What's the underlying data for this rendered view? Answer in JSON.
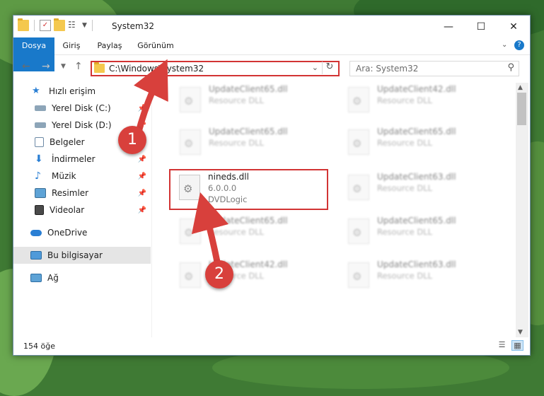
{
  "window": {
    "title": "System32"
  },
  "ribbon": {
    "tabs": [
      "Dosya",
      "Giriş",
      "Paylaş",
      "Görünüm"
    ]
  },
  "address": {
    "path": "C:\\Windows\\System32"
  },
  "search": {
    "placeholder": "Ara: System32"
  },
  "sidebar": {
    "items": [
      {
        "label": "Hızlı erişim",
        "icon": "star-icon"
      },
      {
        "label": "Yerel Disk (C:)",
        "icon": "drive-icon"
      },
      {
        "label": "Yerel Disk (D:)",
        "icon": "drive-icon"
      },
      {
        "label": "Belgeler",
        "icon": "documents-icon"
      },
      {
        "label": "İndirmeler",
        "icon": "download-icon"
      },
      {
        "label": "Müzik",
        "icon": "music-icon"
      },
      {
        "label": "Resimler",
        "icon": "pictures-icon"
      },
      {
        "label": "Videolar",
        "icon": "video-icon"
      },
      {
        "label": "OneDrive",
        "icon": "cloud-icon"
      },
      {
        "label": "Bu bilgisayar",
        "icon": "computer-icon"
      },
      {
        "label": "Ağ",
        "icon": "network-icon"
      }
    ]
  },
  "files": [
    {
      "name": "UpdateClient65.dll",
      "line1": "Resource DLL",
      "blurred": true
    },
    {
      "name": "UpdateClient42.dll",
      "line1": "Resource DLL",
      "blurred": true
    },
    {
      "name": "UpdateClient65.dll",
      "line1": "Resource DLL",
      "blurred": true
    },
    {
      "name": "UpdateClient65.dll",
      "line1": "Resource DLL",
      "blurred": true
    },
    {
      "name": "nineds.dll",
      "line1": "6.0.0.0",
      "line2": "DVDLogic",
      "blurred": false
    },
    {
      "name": "UpdateClient63.dll",
      "line1": "Resource DLL",
      "blurred": true
    },
    {
      "name": "UpdateClient65.dll",
      "line1": "Resource DLL",
      "blurred": true
    },
    {
      "name": "UpdateClient65.dll",
      "line1": "Resource DLL",
      "blurred": true
    },
    {
      "name": "UpdateClient42.dll",
      "line1": "Resource DLL",
      "blurred": true
    },
    {
      "name": "UpdateClient63.dll",
      "line1": "Resource DLL",
      "blurred": true
    }
  ],
  "status": {
    "count": "154 öğe"
  },
  "markers": [
    "1",
    "2"
  ],
  "colors": {
    "accent": "#1979ca",
    "highlight": "#d23434"
  }
}
